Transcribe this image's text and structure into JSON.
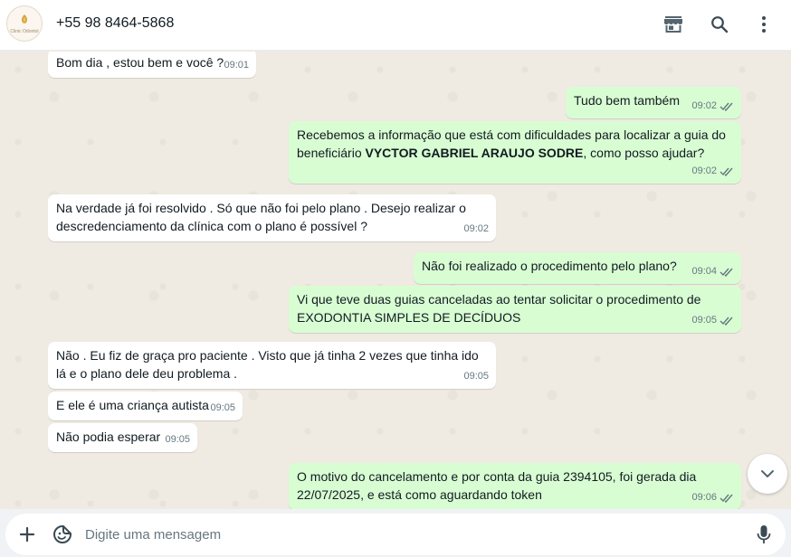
{
  "header": {
    "contact_name": "+55 98 8464-5868",
    "avatar_text": "Clinic Odontol"
  },
  "messages": [
    {
      "dir": "in",
      "text": "Bom dia , estou bem e você ?",
      "time": "09:01"
    },
    {
      "dir": "out",
      "text": "Tudo bem também",
      "time": "09:02",
      "read": true
    },
    {
      "dir": "out",
      "text_before": "Recebemos a informação que está com dificuldades para localizar a guia do beneficiário ",
      "text_bold": "VYCTOR GABRIEL ARAUJO SODRE",
      "text_after": ", como posso ajudar?",
      "time": "09:02",
      "read": true
    },
    {
      "dir": "in",
      "text": "Na verdade já foi resolvido . Só que não foi pelo plano . Desejo realizar o descredenciamento da clínica com o plano é possível ?",
      "time": "09:02"
    },
    {
      "dir": "out",
      "text": "Não foi realizado o procedimento pelo plano?",
      "time": "09:04",
      "read": true
    },
    {
      "dir": "out",
      "text": "Vi que teve duas guias canceladas ao tentar solicitar o procedimento de EXODONTIA SIMPLES DE DECÍDUOS",
      "time": "09:05",
      "read": true
    },
    {
      "dir": "in",
      "text": "Não . Eu fiz de graça pro paciente . Visto que já tinha 2 vezes que tinha ido lá e o plano dele deu problema .",
      "time": "09:05"
    },
    {
      "dir": "in",
      "text": "E ele é uma criança autista",
      "time": "09:05"
    },
    {
      "dir": "in",
      "text": "Não podia esperar",
      "time": "09:05"
    },
    {
      "dir": "out",
      "text": "O motivo do cancelamento e por conta da guia 2394105, foi gerada dia 22/07/2025, e está como aguardando token",
      "time": "09:06",
      "read": true
    }
  ],
  "composer": {
    "placeholder": "Digite uma mensagem"
  },
  "icons": {
    "header": [
      "store-icon",
      "search-icon",
      "menu-dots-icon"
    ],
    "composer": [
      "plus-icon",
      "sticker-icon",
      "mic-icon"
    ],
    "scroll": "chevron-down-icon"
  },
  "colors": {
    "incoming_bubble": "#ffffff",
    "outgoing_bubble": "#d9fdd3",
    "chat_background": "#efeae2",
    "read_ticks": "#667781"
  }
}
